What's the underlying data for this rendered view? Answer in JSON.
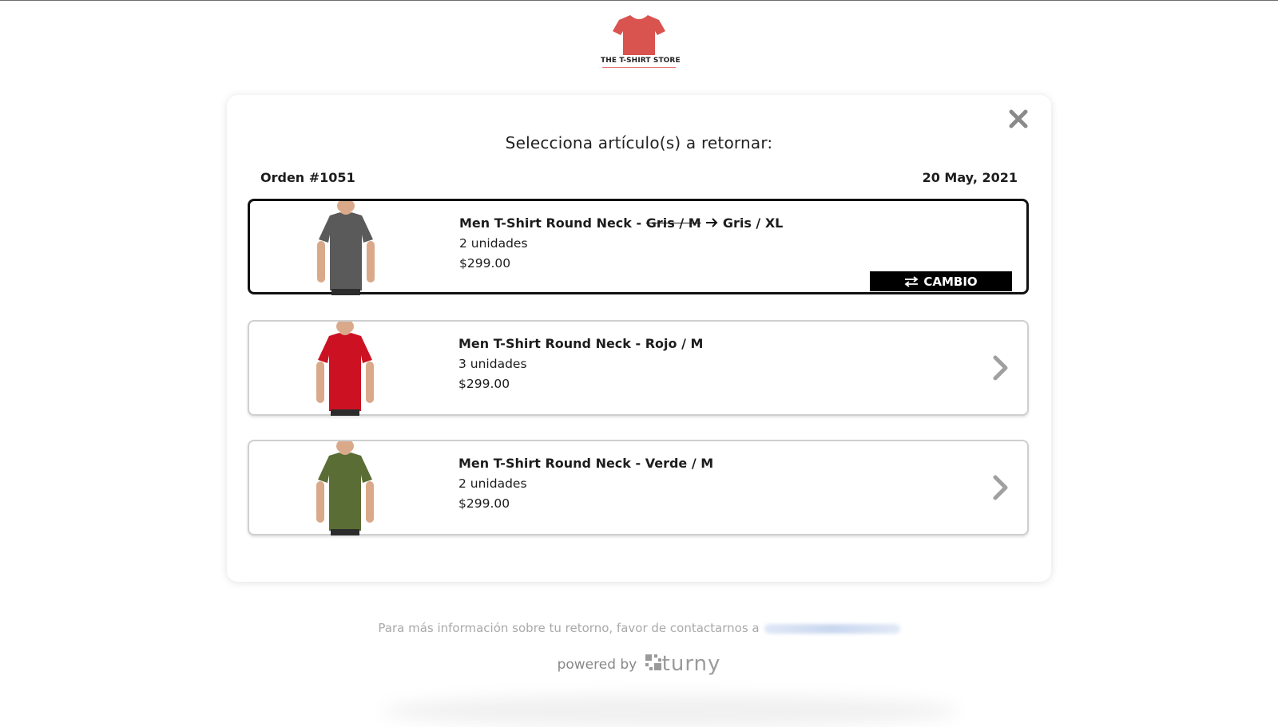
{
  "store": {
    "logo_text": "THE T-SHIRT STORE"
  },
  "modal": {
    "heading": "Selecciona artículo(s) a retornar:",
    "order_number": "Orden #1051",
    "order_date": "20 May, 2021"
  },
  "items": [
    {
      "title_prefix": "Men T-Shirt Round Neck - ",
      "old_variant": "Gris / M",
      "new_variant": "Gris / XL",
      "quantity": "2 unidades",
      "price": "$299.00",
      "badge": "CAMBIO",
      "shirt_color": "#5a5a5a",
      "selected": true
    },
    {
      "title": "Men T-Shirt Round Neck - Rojo / M",
      "quantity": "3 unidades",
      "price": "$299.00",
      "shirt_color": "#cc1222"
    },
    {
      "title": "Men T-Shirt Round Neck - Verde / M",
      "quantity": "2 unidades",
      "price": "$299.00",
      "shirt_color": "#5a6d35"
    }
  ],
  "footer": {
    "contact_text": "Para más información sobre tu retorno, favor de contactarnos a",
    "powered_by": "powered by",
    "brand": "turny"
  },
  "colors": {
    "logo_red": "#d9534f",
    "chevron_gray": "#a0a0a0",
    "selected_border": "#111111"
  }
}
